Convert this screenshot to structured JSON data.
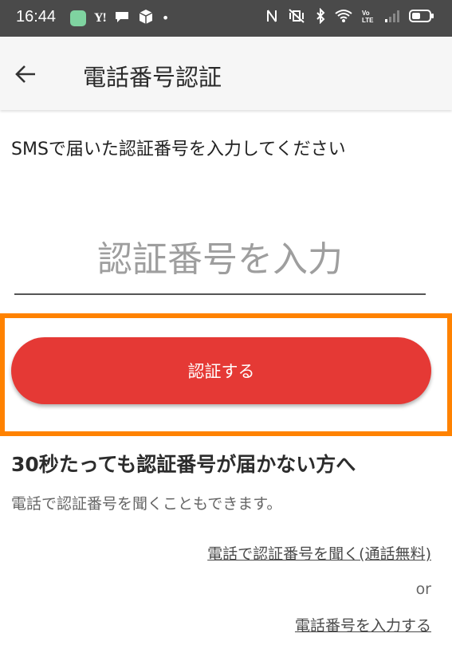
{
  "status_bar": {
    "time": "16:44",
    "left_icons": [
      "app-icon",
      "yahoo-icon",
      "chat-icon",
      "package-icon",
      "dot-icon"
    ],
    "yahoo_label": "Y!",
    "dot": "•",
    "right_icons": [
      "nfc-icon",
      "mute-vibrate-icon",
      "bluetooth-icon",
      "wifi-icon",
      "volte-icon",
      "signal-icon",
      "battery-icon"
    ],
    "volte_label": "Vo LTE"
  },
  "app_bar": {
    "back_icon": "arrow-left-icon",
    "title": "電話番号認証"
  },
  "main": {
    "instruction": "SMSで届いた認証番号を入力してください",
    "code_input": {
      "placeholder": "認証番号を入力",
      "value": ""
    },
    "verify_button_label": "認証する",
    "highlight_color": "#ff8200",
    "button_color": "#e53935"
  },
  "help": {
    "heading": "30秒たっても認証番号が届かない方へ",
    "text": "電話で認証番号を聞くこともできます。",
    "call_link": "電話で認証番号を聞く(通話無料)",
    "or": "or",
    "phone_link": "電話番号を入力する"
  }
}
